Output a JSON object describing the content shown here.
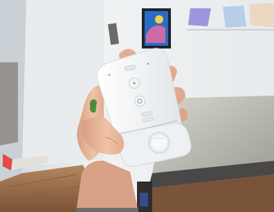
{
  "image": {
    "subject": "",
    "colors": {
      "wall": "#eef0f1",
      "wall_shadow": "#d7dbdd",
      "floor": "#9a6a45",
      "floor_dark": "#6e4a30",
      "counter_top": "#b9b8b0",
      "counter_edge": "#4a4846",
      "device_white": "#f7f8f8",
      "device_shade": "#e3e6e8",
      "skin": "#e7b49a",
      "skin_shadow": "#c98e74",
      "accent_red": "#e04b45",
      "art_blue": "#2b6cc4",
      "art_pink": "#e06aa4"
    }
  }
}
